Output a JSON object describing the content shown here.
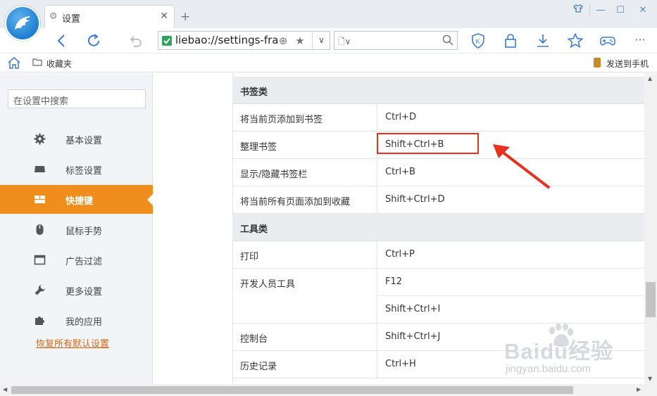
{
  "tab": {
    "title": "设置",
    "icon": "gear-icon"
  },
  "window": {
    "controls": [
      "skin-icon",
      "minimize-icon",
      "maximize-icon",
      "close-icon"
    ]
  },
  "toolbar": {
    "address": {
      "url": "liebao://settings-fra"
    },
    "icons": [
      "back-icon",
      "refresh-icon",
      "undo-icon",
      "extension-icon",
      "star-icon",
      "page-icon",
      "search-icon",
      "shield-icon",
      "lock-icon",
      "download-icon",
      "favorite-icon",
      "gamepad-icon",
      "more-icon"
    ],
    "more_label": "···"
  },
  "favbar": {
    "bookmarks_label": "收藏夹",
    "send_to_phone": "发送到手机"
  },
  "sidebar": {
    "search_placeholder": "在设置中搜索",
    "items": [
      {
        "label": "基本设置",
        "icon": "gear-icon",
        "active": false
      },
      {
        "label": "标签设置",
        "icon": "tab-icon",
        "active": false
      },
      {
        "label": "快捷键",
        "icon": "keyboard-icon",
        "active": true
      },
      {
        "label": "鼠标手势",
        "icon": "mouse-icon",
        "active": false
      },
      {
        "label": "广告过滤",
        "icon": "window-icon",
        "active": false
      },
      {
        "label": "更多设置",
        "icon": "wrench-icon",
        "active": false
      },
      {
        "label": "我的应用",
        "icon": "puzzle-icon",
        "active": false
      }
    ],
    "restore_label": "恢复所有默认设置"
  },
  "shortcuts": {
    "sections": [
      {
        "title": "书签类",
        "rows": [
          {
            "action": "将当前页添加到书签",
            "keys": "Ctrl+D"
          },
          {
            "action": "整理书签",
            "keys": "Shift+Ctrl+B",
            "highlighted": true
          },
          {
            "action": "显示/隐藏书签栏",
            "keys": "Ctrl+B"
          },
          {
            "action": "将当前所有页面添加到收藏",
            "keys": "Shift+Ctrl+D"
          }
        ]
      },
      {
        "title": "工具类",
        "rows": [
          {
            "action": "打印",
            "keys": "Ctrl+P"
          },
          {
            "action": "开发人员工具",
            "keys": "F12"
          },
          {
            "action": "",
            "keys": "Shift+Ctrl+I"
          },
          {
            "action": "控制台",
            "keys": "Shift+Ctrl+J"
          },
          {
            "action": "历史记录",
            "keys": "Ctrl+H"
          }
        ]
      }
    ]
  },
  "annotation": {
    "color": "#e8301f"
  },
  "colors": {
    "accent": "#ef8d1d",
    "link": "#d46a19",
    "brand": "#1e7fd0"
  },
  "watermark": {
    "text": "Baidu经验",
    "url": "jingyan.baidu.com"
  }
}
